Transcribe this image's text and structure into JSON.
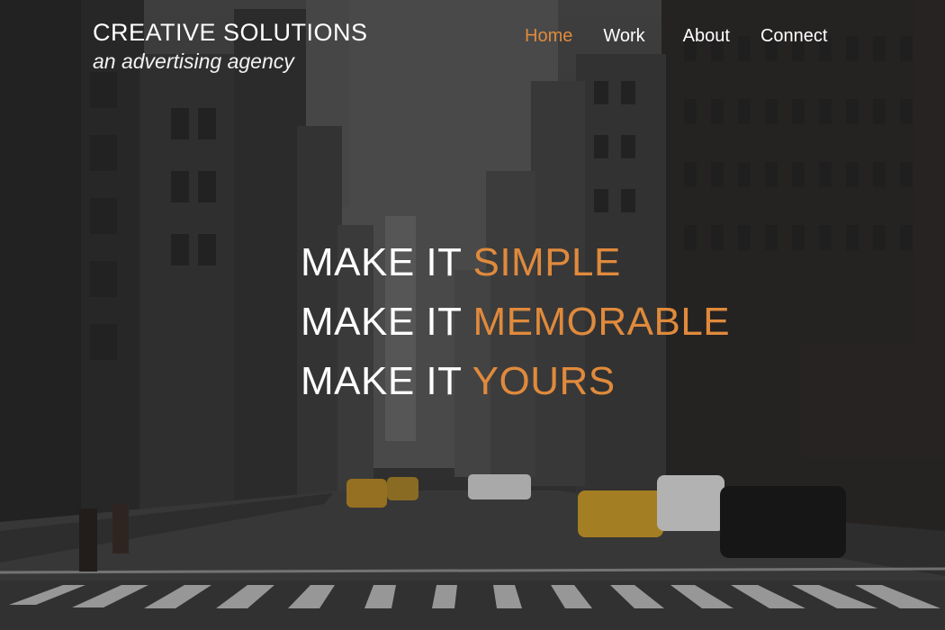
{
  "brand": {
    "title": "CREATIVE SOLUTIONS",
    "subtitle": "an advertising agency"
  },
  "nav": {
    "items": [
      {
        "label": "Home",
        "active": true
      },
      {
        "label": "Work",
        "active": false
      },
      {
        "label": "About",
        "active": false
      },
      {
        "label": "Connect",
        "active": false
      }
    ]
  },
  "headline": {
    "lines": [
      {
        "prefix": "MAKE IT",
        "accent": "SIMPLE"
      },
      {
        "prefix": "MAKE IT",
        "accent": "MEMORABLE"
      },
      {
        "prefix": "MAKE IT",
        "accent": "YOURS"
      }
    ]
  },
  "colors": {
    "accent": "#e08a3c",
    "text": "#ffffff"
  }
}
